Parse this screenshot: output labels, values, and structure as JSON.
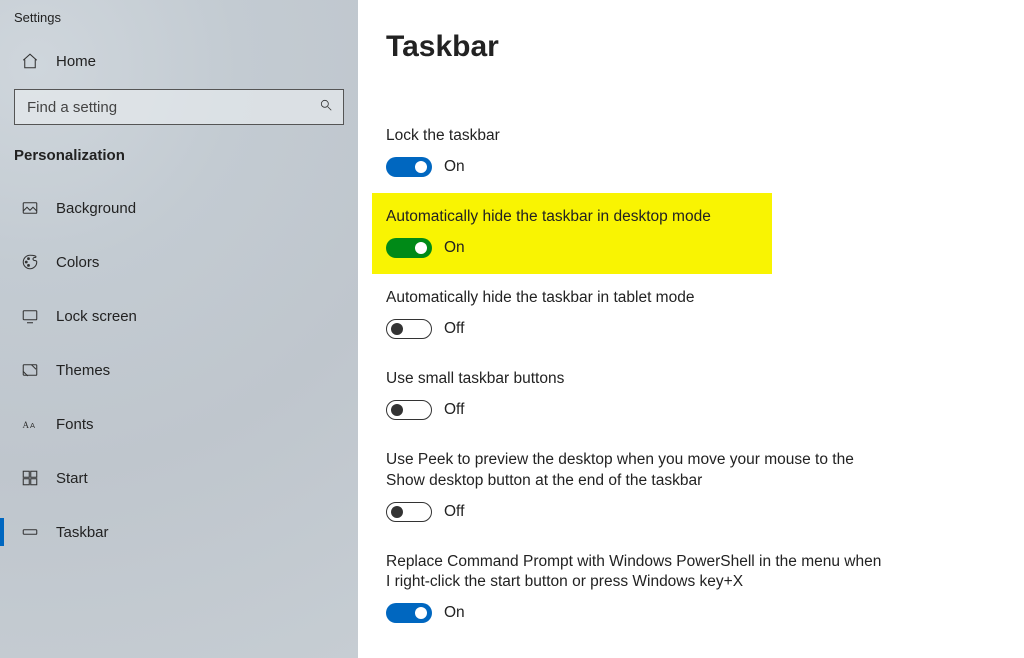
{
  "app_title": "Settings",
  "sidebar": {
    "home_label": "Home",
    "search_placeholder": "Find a setting",
    "category": "Personalization",
    "items": [
      {
        "id": "background",
        "label": "Background"
      },
      {
        "id": "colors",
        "label": "Colors"
      },
      {
        "id": "lock-screen",
        "label": "Lock screen"
      },
      {
        "id": "themes",
        "label": "Themes"
      },
      {
        "id": "fonts",
        "label": "Fonts"
      },
      {
        "id": "start",
        "label": "Start"
      },
      {
        "id": "taskbar",
        "label": "Taskbar"
      }
    ],
    "active_index": 6
  },
  "main": {
    "title": "Taskbar",
    "toggle_state": {
      "on": "On",
      "off": "Off"
    },
    "settings": [
      {
        "id": "lock-taskbar",
        "label": "Lock the taskbar",
        "value": true,
        "color": "blue",
        "highlight": false
      },
      {
        "id": "auto-hide-desktop",
        "label": "Automatically hide the taskbar in desktop mode",
        "value": true,
        "color": "green",
        "highlight": true
      },
      {
        "id": "auto-hide-tablet",
        "label": "Automatically hide the taskbar in tablet mode",
        "value": false,
        "color": "blue",
        "highlight": false
      },
      {
        "id": "small-buttons",
        "label": "Use small taskbar buttons",
        "value": false,
        "color": "blue",
        "highlight": false
      },
      {
        "id": "peek-preview",
        "label": "Use Peek to preview the desktop when you move your mouse to the Show desktop button at the end of the taskbar",
        "value": false,
        "color": "blue",
        "highlight": false
      },
      {
        "id": "powershell-replace",
        "label": "Replace Command Prompt with Windows PowerShell in the menu when I right-click the start button or press Windows key+X",
        "value": true,
        "color": "blue",
        "highlight": false
      }
    ]
  }
}
